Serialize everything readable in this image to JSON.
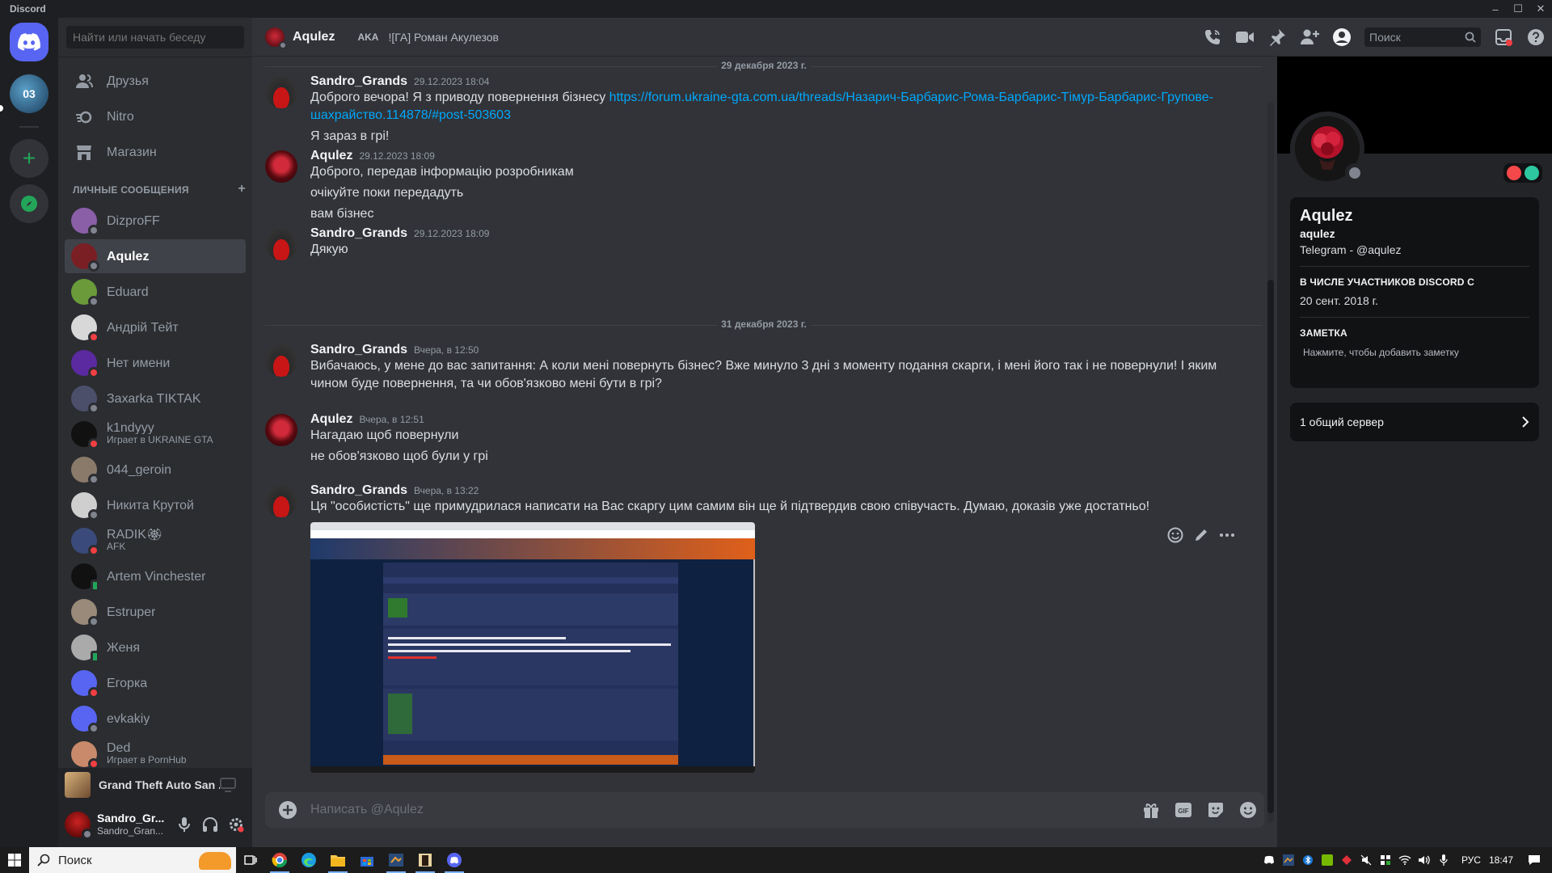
{
  "window": {
    "title": "Discord"
  },
  "colors": {
    "blurple": "#5865f2",
    "link": "#00a8fc",
    "online": "#23a559",
    "dnd": "#f23f43",
    "offline": "#80848e"
  },
  "sidebar": {
    "search_placeholder": "Найти или начать беседу",
    "nav": [
      {
        "label": "Друзья",
        "icon": "friends-icon"
      },
      {
        "label": "Nitro",
        "icon": "nitro-icon"
      },
      {
        "label": "Магазин",
        "icon": "shop-icon"
      }
    ],
    "dm_header": "ЛИЧНЫЕ СООБЩЕНИЯ",
    "dm_add": "+",
    "dms": [
      {
        "name": "DizproFF",
        "status": "offline",
        "color": "#8a5fa8"
      },
      {
        "name": "Aqulez",
        "status": "offline",
        "color": "#7a1f24",
        "active": true
      },
      {
        "name": "Eduard",
        "status": "offline",
        "color": "#6a9a3a"
      },
      {
        "name": "Андрій Тейт",
        "status": "dnd",
        "color": "#d8d8d8"
      },
      {
        "name": "Нет имени",
        "status": "dnd",
        "color": "#5b2aa0"
      },
      {
        "name": "Захаrka TIKTAK",
        "status": "offline",
        "color": "#4b4f6a"
      },
      {
        "name": "k1ndyyy",
        "sub": "Играет в UKRAINE GTA",
        "status": "dnd",
        "color": "#111"
      },
      {
        "name": "044_geroin",
        "status": "offline",
        "color": "#8a7a6a"
      },
      {
        "name": "Никита Крутой",
        "status": "offline",
        "color": "#cfcfcf"
      },
      {
        "name": "RADIK🏵",
        "sub": "AFK",
        "status": "dnd",
        "color": "#3a4a7a"
      },
      {
        "name": "Artem Vinchester",
        "status": "mobile",
        "color": "#111"
      },
      {
        "name": "Estruper",
        "status": "offline",
        "color": "#9a8a7a"
      },
      {
        "name": "Женя",
        "status": "mobile",
        "color": "#aaa"
      },
      {
        "name": "Егорка",
        "status": "dnd",
        "color": "#5865f2"
      },
      {
        "name": "evkakiy",
        "status": "offline",
        "color": "#5865f2"
      },
      {
        "name": "Ded",
        "sub": "Играет в PornHub",
        "status": "dnd",
        "color": "#c88a6a"
      }
    ],
    "activity": {
      "game": "Grand Theft Auto San ..."
    },
    "user": {
      "name": "Sandro_Gr...",
      "tag": "Sandro_Gran..."
    }
  },
  "header": {
    "title": "Aqulez",
    "aka_label": "AKA",
    "aka_value": "![ГА] Роман Акулезов",
    "search_placeholder": "Поиск"
  },
  "chat": {
    "dividers": [
      "29 декабря 2023 г.",
      "31 декабря 2023 г."
    ],
    "messages": [
      {
        "author": "Sandro_Grands",
        "time": "29.12.2023 18:04",
        "lines": [
          "Доброго вечора! Я з приводу повернення бізнесу ",
          "Я зараз в грі!"
        ],
        "link": "https://forum.ukraine-gta.com.ua/threads/Назарич-Барбарис-Рома-Барбарис-Тімур-Барбарис-Групове-шахрайство.114878/#post-503603"
      },
      {
        "author": "Aqulez",
        "time": "29.12.2023 18:09",
        "lines": [
          "Доброго, передав інформацію розробникам",
          "очікуйте поки передадуть",
          "вам бізнес"
        ]
      },
      {
        "author": "Sandro_Grands",
        "time": "29.12.2023 18:09",
        "lines": [
          "Дякую"
        ]
      },
      {
        "author": "Sandro_Grands",
        "time": "Вчера, в 12:50",
        "lines": [
          "Вибачаюсь, у мене до вас запитання: А коли мені повернуть бізнес? Вже минуло 3 дні з моменту подання скарги, і мені його так і не повернули! І яким чином буде повернення, та чи обов'язково мені бути в грі?"
        ]
      },
      {
        "author": "Aqulez",
        "time": "Вчера, в 12:51",
        "lines": [
          "Нагадаю щоб повернули",
          "не обов'язково щоб були у грі"
        ]
      },
      {
        "author": "Sandro_Grands",
        "time": "Вчера, в 13:22",
        "lines": [
          "Ця \"особистість\" ще примудрилася написати на Вас скаргу цим самим він ще й підтвердив свою співучасть. Думаю, доказів уже достатньо!"
        ]
      }
    ],
    "composer_placeholder": "Написать @Aqulez"
  },
  "profile": {
    "display_name": "Aqulez",
    "username": "aqulez",
    "custom_status": "Telegram - @aqulez",
    "member_since_label": "В ЧИСЛЕ УЧАСТНИКОВ DISCORD С",
    "member_since": "20 сент. 2018 г.",
    "note_label": "ЗАМЕТКА",
    "note_placeholder": "Нажмите, чтобы добавить заметку",
    "mutual_servers": "1 общий сервер"
  },
  "guilds": {
    "server_label": "03"
  },
  "taskbar": {
    "search_label": "Поиск",
    "lang": "РУС",
    "time": "18:47"
  }
}
